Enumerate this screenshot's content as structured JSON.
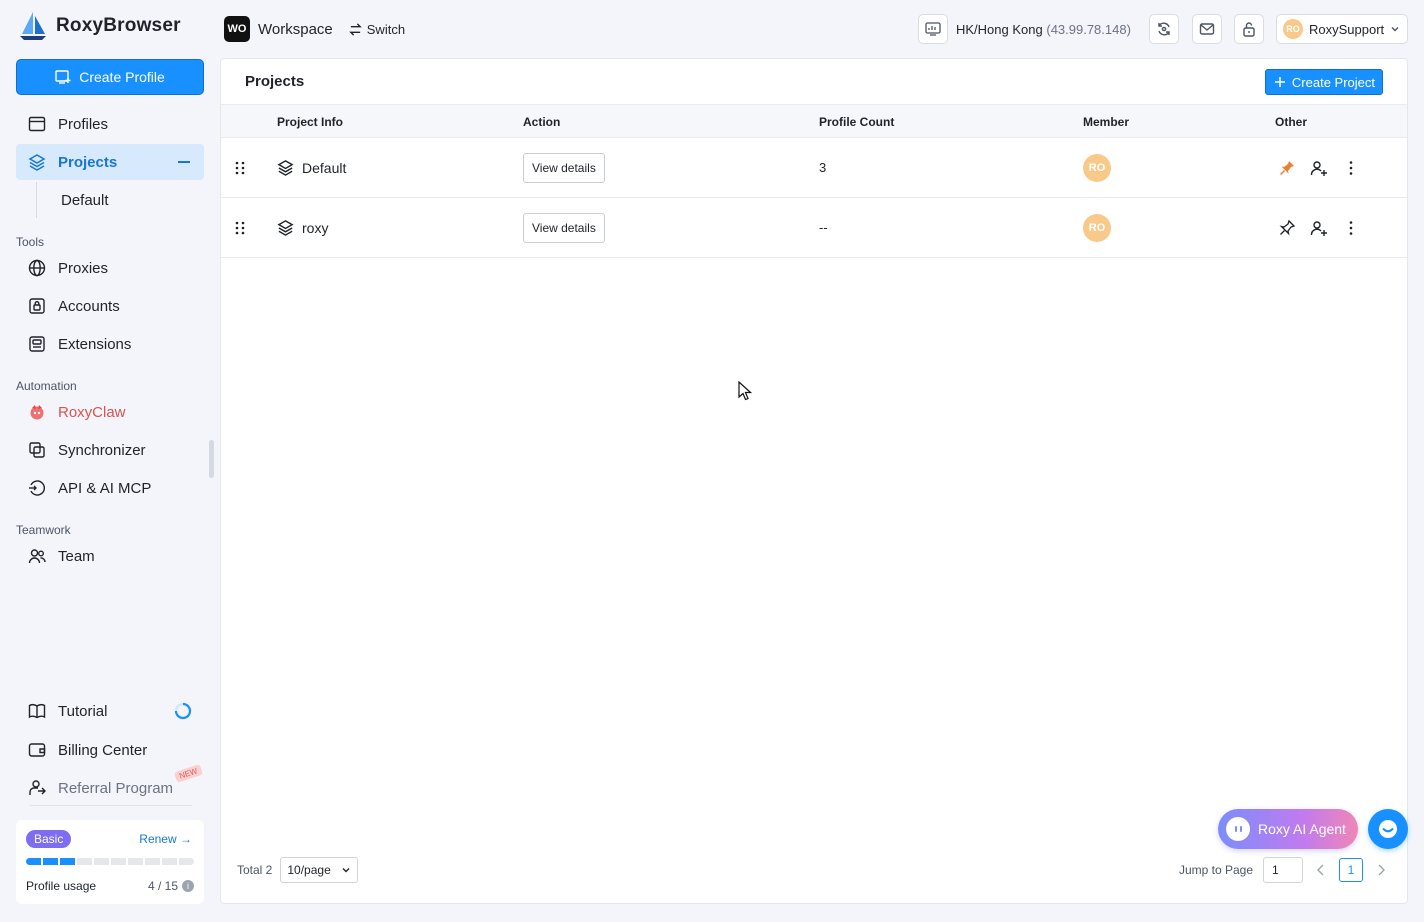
{
  "app": {
    "name": "RoxyBrowser"
  },
  "workspace": {
    "badge": "WO",
    "name": "Workspace",
    "switch_label": "Switch"
  },
  "proxy": {
    "location": "HK/Hong Kong",
    "ip": "(43.99.78.148)"
  },
  "user": {
    "initials": "RO",
    "name": "RoxySupport"
  },
  "sidebar": {
    "create_profile_label": "Create Profile",
    "profiles_label": "Profiles",
    "projects_label": "Projects",
    "projects_sub": [
      "Default"
    ],
    "tools_heading": "Tools",
    "tools": [
      "Proxies",
      "Accounts",
      "Extensions"
    ],
    "automation_heading": "Automation",
    "automation": [
      "RoxyClaw",
      "Synchronizer",
      "API & AI MCP"
    ],
    "teamwork_heading": "Teamwork",
    "teamwork": [
      "Team"
    ],
    "bottom": [
      "Tutorial",
      "Billing Center",
      "Referral Program"
    ],
    "new_badge": "NEW",
    "plan": {
      "name": "Basic",
      "renew_label": "Renew",
      "usage_label": "Profile usage",
      "usage_value": "4 / 15",
      "segments_total": 10,
      "segments_used": 3
    }
  },
  "main": {
    "title": "Projects",
    "create_project_label": "Create Project",
    "columns": [
      "Project Info",
      "Action",
      "Profile Count",
      "Member",
      "Other"
    ],
    "rows": [
      {
        "name": "Default",
        "action": "View details",
        "count": "3",
        "member": "RO",
        "pinned": true
      },
      {
        "name": "roxy",
        "action": "View details",
        "count": "--",
        "member": "RO",
        "pinned": false
      }
    ],
    "pager": {
      "total_label": "Total 2",
      "page_size": "10/page",
      "jump_label": "Jump to Page",
      "jump_value": "1",
      "current_page": "1"
    }
  },
  "floating": {
    "ai_agent_label": "Roxy AI Agent"
  },
  "colors": {
    "accent": "#1890ff",
    "active_bg": "#d7e9fd",
    "pin": "#f07c2e",
    "avatar": "#f9c98a"
  }
}
